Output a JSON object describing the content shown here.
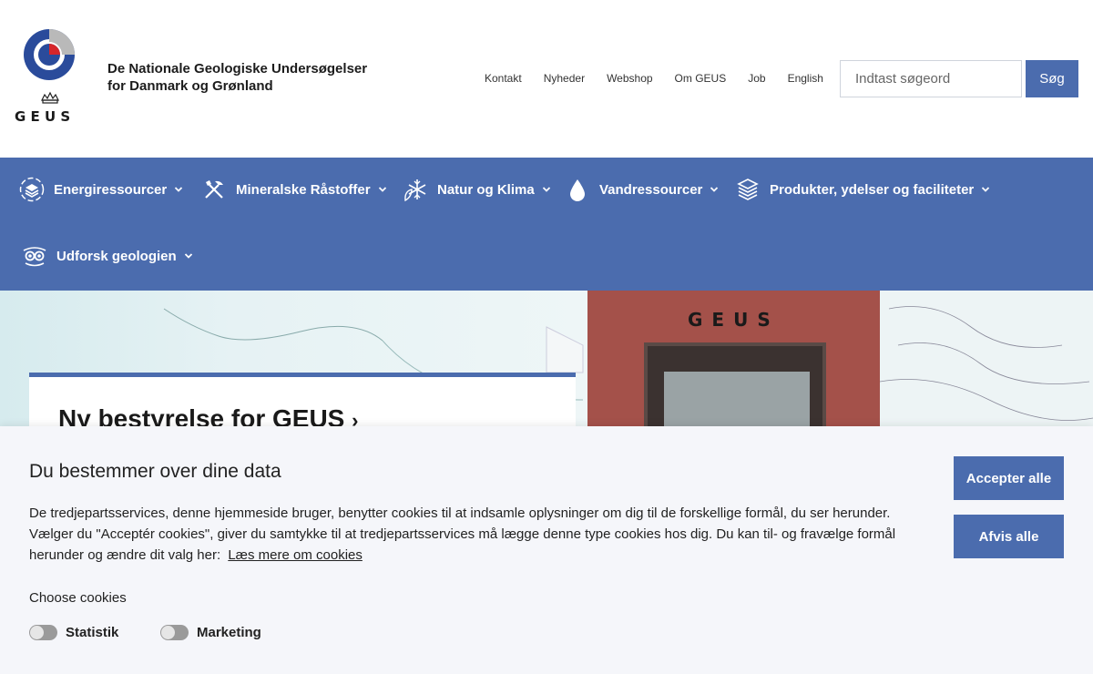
{
  "header": {
    "logo_text": "G E U S",
    "org_name_line1": "De Nationale Geologiske Undersøgelser",
    "org_name_line2": "for Danmark og Grønland",
    "top_links": [
      "Kontakt",
      "Nyheder",
      "Webshop",
      "Om GEUS",
      "Job",
      "English"
    ],
    "search_placeholder": "Indtast søgeord",
    "search_button": "Søg"
  },
  "mainnav": {
    "items": [
      {
        "label": "Energiressourcer",
        "icon": "energy-layers-icon"
      },
      {
        "label": "Mineralske Råstoffer",
        "icon": "tools-icon"
      },
      {
        "label": "Natur og Klima",
        "icon": "snowflake-leaf-icon"
      },
      {
        "label": "Vandressourcer",
        "icon": "water-drop-icon"
      },
      {
        "label": "Produkter, ydelser og faciliteter",
        "icon": "stack-icon"
      },
      {
        "label": "Udforsk geologien",
        "icon": "binoculars-icon"
      }
    ]
  },
  "hero": {
    "card_title": "Ny bestyrelse for GEUS",
    "sign_text": "GEUS"
  },
  "cookie": {
    "title": "Du bestemmer over dine data",
    "text": "De tredjepartsservices, denne hjemmeside bruger, benytter cookies til at indsamle oplysninger om dig til de forskellige formål, du ser herunder. Vælger du \"Acceptér cookies\", giver du samtykke til at tredjepartsservices må lægge denne type cookies hos dig. Du kan til- og fravælge formål herunder og ændre dit valg her:",
    "link": "Læs mere om cookies",
    "choose_label": "Choose cookies",
    "toggles": [
      {
        "label": "Statistik",
        "on": false
      },
      {
        "label": "Marketing",
        "on": false
      }
    ],
    "accept_all": "Accepter alle",
    "reject_all": "Afvis alle"
  },
  "colors": {
    "brand_blue": "#4b6cae",
    "banner_bg": "#f5f6fa"
  }
}
